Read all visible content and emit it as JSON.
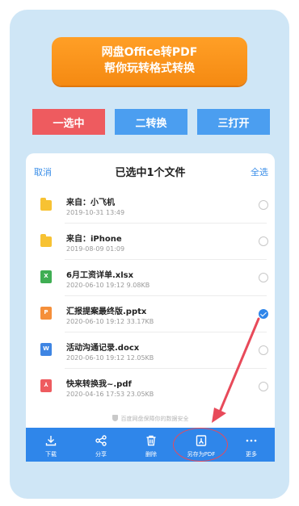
{
  "banner": {
    "line1": "网盘Office转PDF",
    "line2": "帮你玩转格式转换"
  },
  "steps": [
    "一选中",
    "二转换",
    "三打开"
  ],
  "header": {
    "cancel": "取消",
    "title": "已选中1个文件",
    "select_all": "全选"
  },
  "files": [
    {
      "name": "来自：小飞机",
      "meta": "2019-10-31  13:49",
      "type": "folder",
      "selected": false
    },
    {
      "name": "来自：iPhone",
      "meta": "2019-08-09  01:09",
      "type": "folder",
      "selected": false
    },
    {
      "name": "6月工资详单.xlsx",
      "meta": "2020-06-10  19:12   9.08KB",
      "type": "xlsx",
      "icon_letter": "X",
      "selected": false
    },
    {
      "name": "汇报提案最终版.pptx",
      "meta": "2020-06-10  19:12   33.17KB",
      "type": "pptx",
      "icon_letter": "P",
      "selected": true
    },
    {
      "name": "活动沟通记录.docx",
      "meta": "2020-06-10  19:12   12.05KB",
      "type": "docx",
      "icon_letter": "W",
      "selected": false
    },
    {
      "name": "快来转换我~.pdf",
      "meta": "2020-04-16  17:53   23.05KB",
      "type": "pdf",
      "icon_letter": "⅄",
      "selected": false
    }
  ],
  "safe_text": "百度网盘保障你的数据安全",
  "toolbar": [
    {
      "label": "下载",
      "icon": "download-icon"
    },
    {
      "label": "分享",
      "icon": "share-icon"
    },
    {
      "label": "删除",
      "icon": "trash-icon"
    },
    {
      "label": "另存为PDF",
      "icon": "pdf-icon"
    },
    {
      "label": "更多",
      "icon": "more-icon"
    }
  ],
  "colors": {
    "accent": "#2f86ea",
    "banner": "#f58a12",
    "step_active": "#ee5b5f",
    "background": "#cfe6f6",
    "annotation": "#e84a5a"
  }
}
